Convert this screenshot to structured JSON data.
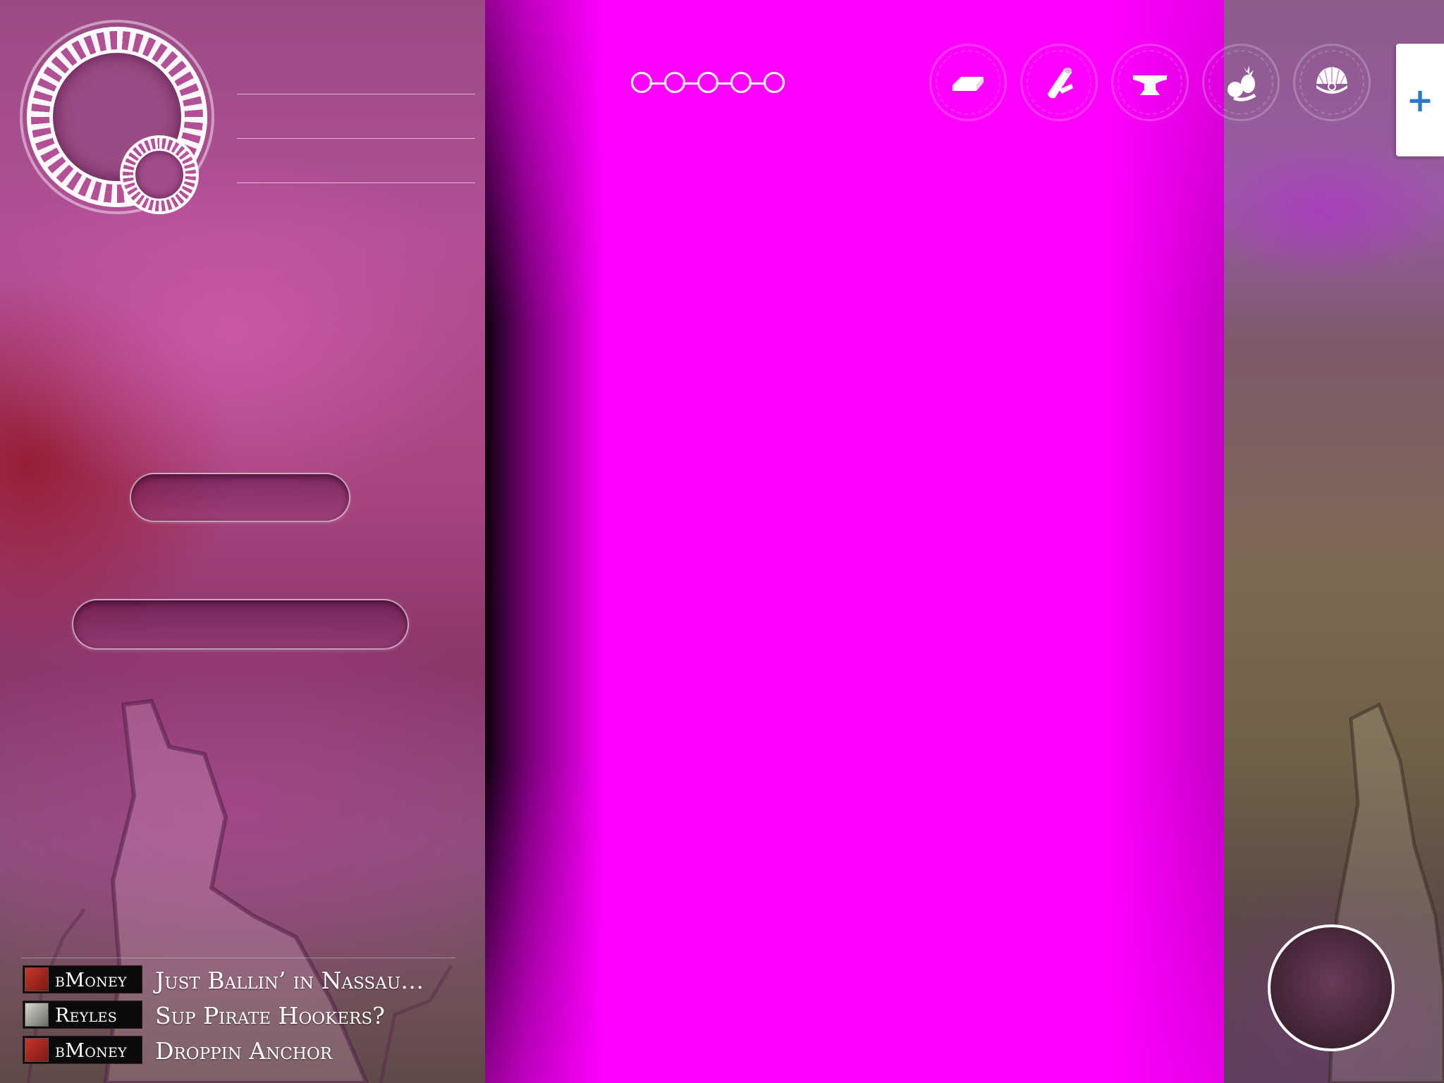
{
  "profile": {
    "avatar": "player-avatar-empty",
    "badge": "level-badge-empty"
  },
  "progress": {
    "chain_nodes": 5
  },
  "resources": [
    {
      "id": "gold",
      "icon": "gold-bar-icon"
    },
    {
      "id": "wood",
      "icon": "lumber-log-icon"
    },
    {
      "id": "iron",
      "icon": "anvil-icon"
    },
    {
      "id": "food",
      "icon": "fruit-icon"
    },
    {
      "id": "pearl",
      "icon": "pearl-shell-icon"
    }
  ],
  "add_button": {
    "label": "+",
    "color": "#2a7ac8"
  },
  "chat": {
    "messages": [
      {
        "user": "bMoney",
        "text": "Just Ballin’ in Nassau…",
        "icon": "red-pirate-portrait"
      },
      {
        "user": "Reyles",
        "text": "Sup Pirate Hookers?",
        "icon": "skeleton-portrait"
      },
      {
        "user": "bMoney",
        "text": "Droppin Anchor",
        "icon": "red-pirate-portrait"
      }
    ]
  },
  "colors": {
    "center_background": "#ff00ff",
    "chat_name_background": "#0c0a0a"
  }
}
